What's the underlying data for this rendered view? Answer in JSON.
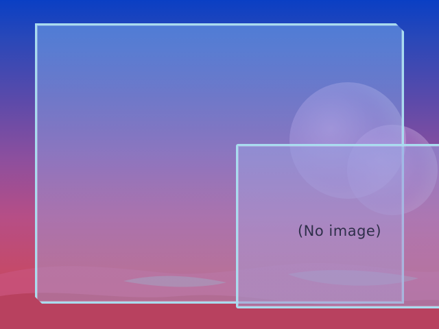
{
  "preview": {
    "placeholder_text": "(No image)"
  },
  "colors": {
    "panel_border": "#a9dcef",
    "sky_top": "#0a3fc4",
    "desert": "#c44a6a",
    "placeholder_text": "#2f2f4a"
  },
  "icons": [
    "moon-decoration",
    "dunes-decoration"
  ]
}
